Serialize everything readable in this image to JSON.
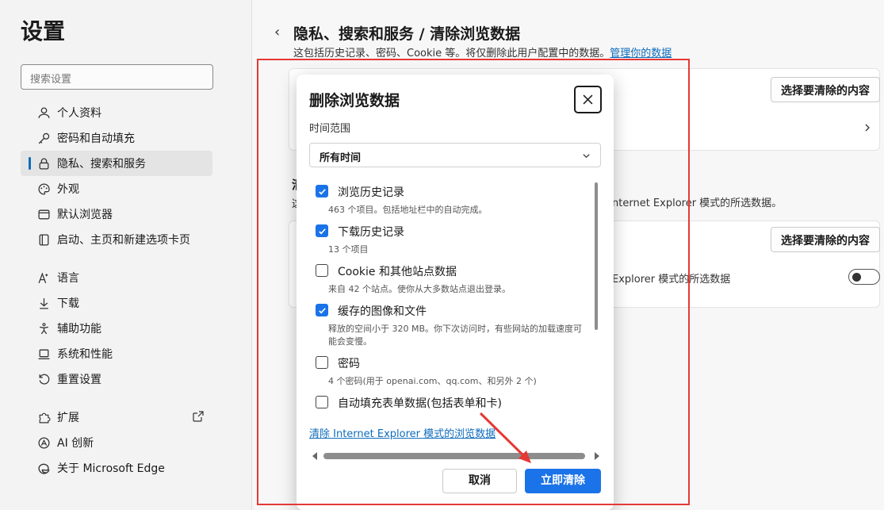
{
  "sidebar": {
    "title": "设置",
    "search_placeholder": "搜索设置",
    "items": [
      {
        "label": "个人资料",
        "icon": "person-icon"
      },
      {
        "label": "密码和自动填充",
        "icon": "key-icon"
      },
      {
        "label": "隐私、搜索和服务",
        "icon": "lock-icon"
      },
      {
        "label": "外观",
        "icon": "palette-icon"
      },
      {
        "label": "默认浏览器",
        "icon": "browser-icon"
      },
      {
        "label": "启动、主页和新建选项卡页",
        "icon": "home-icon"
      },
      {
        "label": "语言",
        "icon": "language-icon"
      },
      {
        "label": "下载",
        "icon": "download-icon"
      },
      {
        "label": "辅助功能",
        "icon": "accessibility-icon"
      },
      {
        "label": "系统和性能",
        "icon": "laptop-icon"
      },
      {
        "label": "重置设置",
        "icon": "reset-icon"
      },
      {
        "label": "扩展",
        "icon": "puzzle-icon"
      },
      {
        "label": "AI 创新",
        "icon": "ai-icon"
      },
      {
        "label": "关于 Microsoft Edge",
        "icon": "edge-icon"
      }
    ]
  },
  "main": {
    "back": "‹",
    "title": "隐私、搜索和服务 / 清除浏览数据",
    "subtitle": "这包括历史记录、密码、Cookie 等。将仅删除此用户配置中的数据。",
    "subtitle_link": "管理你的数据",
    "choose_button_1": "选择要清除的内容",
    "choose_button_2": "选择要清除的内容",
    "bg_ie_text": "nternet Explorer 模式的所选数据。",
    "bg_ie_text2": "Explorer 模式的所选数据",
    "section_fragment": "清",
    "section_fragment2": "这"
  },
  "dialog": {
    "title": "删除浏览数据",
    "time_range_label": "时间范围",
    "time_range_value": "所有时间",
    "items": [
      {
        "label": "浏览历史记录",
        "desc": "463 个项目。包括地址栏中的自动完成。",
        "checked": true
      },
      {
        "label": "下载历史记录",
        "desc": "13 个项目",
        "checked": true
      },
      {
        "label": "Cookie 和其他站点数据",
        "desc": "来自 42 个站点。使你从大多数站点退出登录。",
        "checked": false
      },
      {
        "label": "缓存的图像和文件",
        "desc": "释放的空间小于 320 MB。你下次访问时，有些网站的加载速度可能会变慢。",
        "checked": true
      },
      {
        "label": "密码",
        "desc": "4 个密码(用于 openai.com、qq.com、和另外 2 个)",
        "checked": false
      },
      {
        "label": "自动填充表单数据(包括表单和卡)",
        "desc": "",
        "checked": false
      }
    ],
    "ie_link": "清除 Internet Explorer 模式的浏览数据",
    "cancel": "取消",
    "clear_now": "立即清除"
  },
  "colors": {
    "accent": "#1a73e8",
    "link": "#0f6cbd",
    "annotation": "#e53935"
  }
}
